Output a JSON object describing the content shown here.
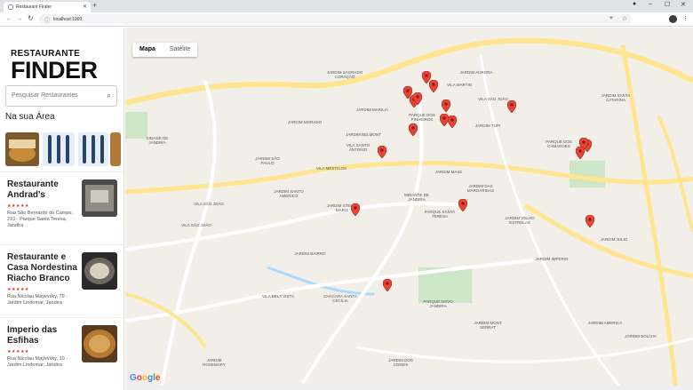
{
  "browser": {
    "tab_title": "Restaurant Finder",
    "url": "localhost:1000"
  },
  "sidebar": {
    "logo_top": "RESTAURANTE",
    "logo_main": "FINDER",
    "search_placeholder": "Pesquisar Restaurantes",
    "section_title": "Na sua Área",
    "thumbs": [
      {
        "label": "Bar do Cangaceiro Burger"
      },
      {
        "label": "cutlery"
      },
      {
        "label": "cutlery"
      },
      {
        "label": "food"
      }
    ],
    "cards": [
      {
        "name": "Restaurante Andrad's",
        "stars": "★★★★★",
        "address": "Rua São Bernardo do Campo, 210 - Parque Santa Teresa, Jandira"
      },
      {
        "name": "Restaurante e Casa Nordestina Riacho Branco",
        "stars": "★★★★★",
        "address": "Rua Nicolau Mayevsky, 79 - Jardim Lindomar, Jandira"
      },
      {
        "name": "Imperio das Esfihas",
        "stars": "★★★★★",
        "address": "Rua Nicolau Mayevsky, 10 - Jardim Lindomar, Jandira"
      }
    ]
  },
  "map": {
    "tab_map": "Mapa",
    "tab_satellite": "Satélite",
    "labels": [
      "JARDIM SAGRADO CORAÇÃO",
      "JARDIM AURORA",
      "VILA MARTIN",
      "JARDIM MARILIA",
      "VILA SÃO JOÃO",
      "JARDIM MORADO",
      "JARDIM BELMONT",
      "VILA SANTO ANTONIO",
      "PARQUE DOS PINHEIROS",
      "VILA MESTICOS",
      "JARDIM MASE",
      "JARDIM TUPI",
      "PARQUE DOS CAMAROES",
      "JARDIM SANTA CATARINA",
      "JARDIM SÃO PAULO",
      "JARDIM SANTO AMERICO",
      "JARDIM STELLA MARIS",
      "MIRANTE DE JANDIRA",
      "JARDIM DAS MARGARIDAS",
      "VILA SÃO JOÃO",
      "PARQUE SANTA TERESA",
      "JARDIM VELHO ESTRELAS",
      "JARDIM JULIO",
      "JARDIM BAIRRO",
      "JARDIM DOS CISNES",
      "VILA BELA VISTA",
      "CHÁCARA SANTA CECÍLIA",
      "PARQUE NOVO JANDIRA",
      "JARDIM IMPERIO",
      "JARDIM AMERICA",
      "JARDIM ROSEMARY",
      "JARDIM BOLIVIA",
      "CIDADE DE JANDIRA",
      "VILA SÃO JOÃO",
      "JARDIM MONT SERRAT"
    ]
  },
  "colors": {
    "pin": "#ea4335",
    "water": "#aadaff",
    "road": "#ffe58f",
    "park": "#cde6c7"
  }
}
